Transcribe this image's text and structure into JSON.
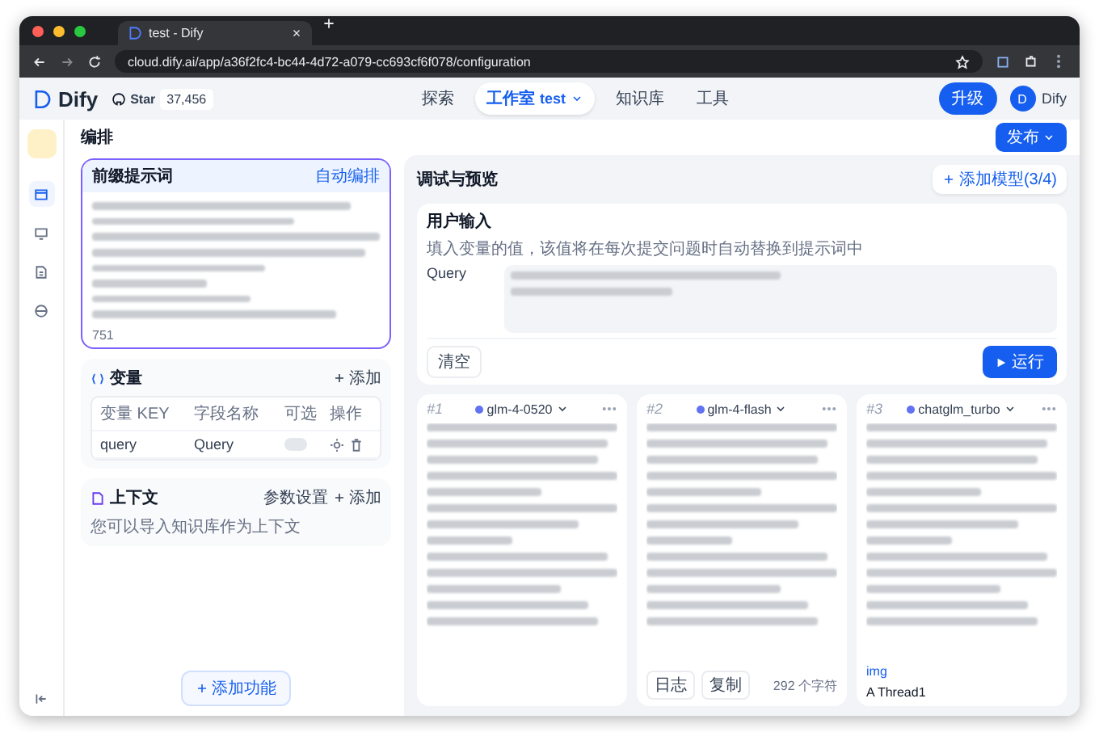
{
  "browser": {
    "tab_title": "test - Dify",
    "url": "cloud.dify.ai/app/a36f2fc4-bc44-4d72-a079-cc693cf6f078/configuration"
  },
  "header": {
    "logo": "Dify",
    "github": {
      "label": "Star",
      "count": "37,456"
    },
    "nav": [
      {
        "label": "探索",
        "selected": false
      },
      {
        "label": "工作室",
        "selected": true,
        "sub": "test"
      },
      {
        "label": "知识库",
        "selected": false
      },
      {
        "label": "工具",
        "selected": false
      }
    ],
    "upgrade": "升级",
    "account": {
      "initial": "D",
      "name": "Dify"
    }
  },
  "sidebar": {
    "items": [
      {
        "selected": true
      },
      {
        "selected": false
      },
      {
        "selected": false
      },
      {
        "selected": false
      }
    ]
  },
  "page_title": "编排",
  "publish": "发布",
  "prompt": {
    "title": "前缀提示词",
    "auto": "自动编排",
    "count": "751"
  },
  "variables": {
    "title": "变量",
    "add": "添加",
    "columns": [
      "变量 KEY",
      "字段名称",
      "可选",
      "操作"
    ],
    "rows": [
      {
        "key": "query",
        "name": "Query",
        "optional": false
      }
    ]
  },
  "context": {
    "title": "上下文",
    "settings": "参数设置",
    "add": "添加",
    "hint": "您可以导入知识库作为上下文"
  },
  "add_features": "添加功能",
  "debug": {
    "title": "调试与预览",
    "add_model": "添加模型(3/4)",
    "user_input": {
      "title": "用户输入",
      "hint": "填入变量的值，该值将在每次提交问题时自动替换到提示词中",
      "fields": [
        {
          "label": "Query"
        }
      ]
    },
    "clear": "清空",
    "run": "运行",
    "models": [
      {
        "index": "#1",
        "name": "glm-4-0520"
      },
      {
        "index": "#2",
        "name": "glm-4-flash",
        "actions": [
          "日志",
          "复制"
        ],
        "count": "292 个字符"
      },
      {
        "index": "#3",
        "name": "chatglm_turbo",
        "tail": [
          "img",
          "A Thread1"
        ]
      }
    ]
  }
}
